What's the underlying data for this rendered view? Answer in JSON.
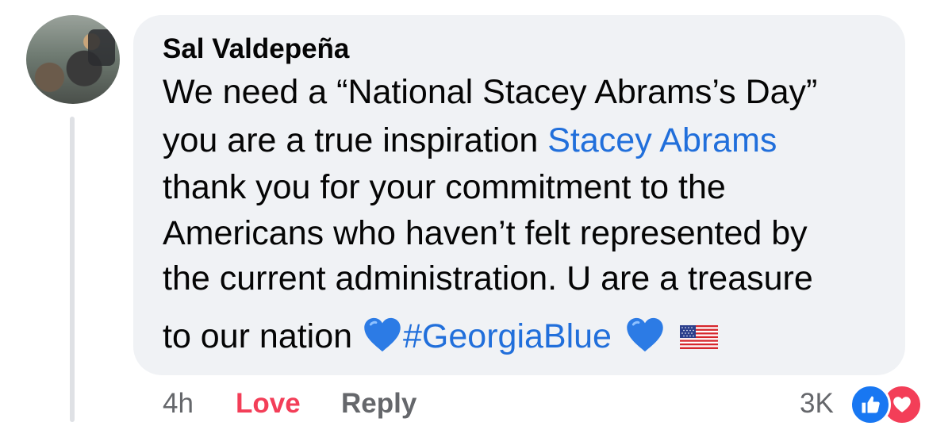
{
  "comment": {
    "author": "Sal Valdepeña",
    "lines": {
      "l1": "We need a “National Stacey Abrams’s Day”",
      "l2_pre": "you are a true inspiration ",
      "l2_mention": "Stacey Abrams",
      "l3": "thank you for your commitment to the",
      "l4": "Americans who haven’t felt represented by",
      "l5": "the current administration. U are a treasure",
      "l6_pre": "to our nation ",
      "l6_hashtag": "#GeorgiaBlue"
    }
  },
  "actions": {
    "time": "4h",
    "love": "Love",
    "reply": "Reply"
  },
  "reactions": {
    "count": "3K",
    "types": [
      "like-icon",
      "love-icon"
    ]
  },
  "colors": {
    "link": "#216fdb",
    "love": "#f33e58",
    "like": "#1877f2",
    "bubble": "#f0f2f5",
    "muted": "#65676b"
  }
}
